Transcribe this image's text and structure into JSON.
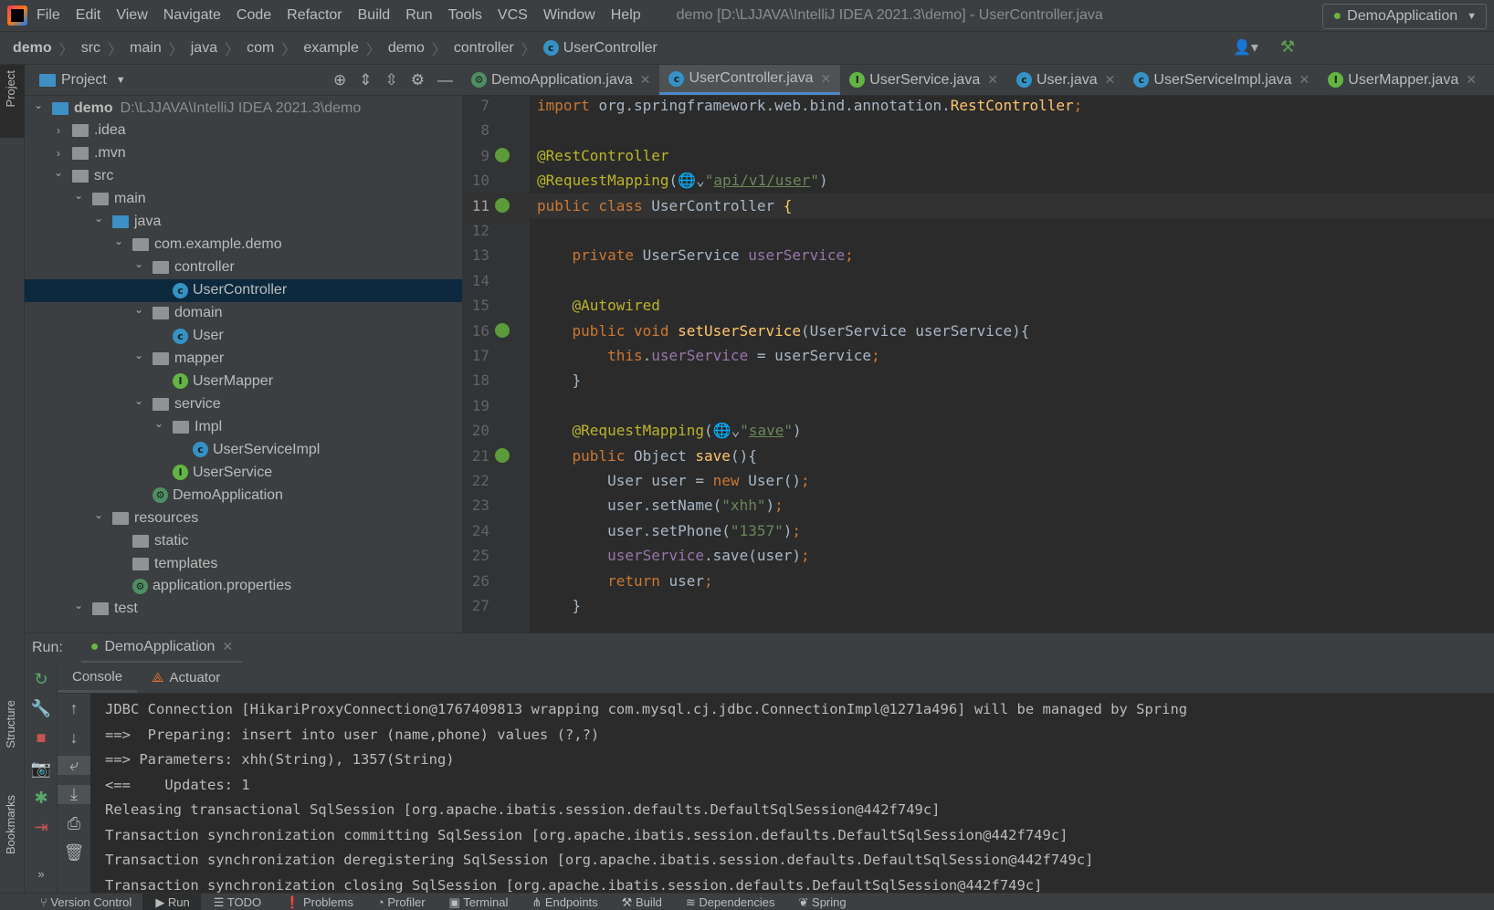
{
  "menubar": {
    "items": [
      "File",
      "Edit",
      "View",
      "Navigate",
      "Code",
      "Refactor",
      "Build",
      "Run",
      "Tools",
      "VCS",
      "Window",
      "Help"
    ],
    "window_title": "demo [D:\\LJJAVA\\IntelliJ IDEA 2021.3\\demo] - UserController.java"
  },
  "breadcrumb": [
    "demo",
    "src",
    "main",
    "java",
    "com",
    "example",
    "demo",
    "controller",
    "UserController"
  ],
  "run_config": {
    "label": "DemoApplication"
  },
  "side_strip": {
    "project": "Project",
    "structure": "Structure",
    "bookmarks": "Bookmarks"
  },
  "project_panel": {
    "title": "Project"
  },
  "tree": [
    {
      "label": "demo",
      "path": "D:\\LJJAVA\\IntelliJ IDEA 2021.3\\demo",
      "depth": 0,
      "exp": "open",
      "icon": "module"
    },
    {
      "label": ".idea",
      "depth": 1,
      "exp": "closed",
      "icon": "folder"
    },
    {
      "label": ".mvn",
      "depth": 1,
      "exp": "closed",
      "icon": "folder"
    },
    {
      "label": "src",
      "depth": 1,
      "exp": "open",
      "icon": "folder"
    },
    {
      "label": "main",
      "depth": 2,
      "exp": "open",
      "icon": "folder"
    },
    {
      "label": "java",
      "depth": 3,
      "exp": "open",
      "icon": "source-folder"
    },
    {
      "label": "com.example.demo",
      "depth": 4,
      "exp": "open",
      "icon": "package"
    },
    {
      "label": "controller",
      "depth": 5,
      "exp": "open",
      "icon": "package"
    },
    {
      "label": "UserController",
      "depth": 6,
      "icon": "class",
      "selected": true
    },
    {
      "label": "domain",
      "depth": 5,
      "exp": "open",
      "icon": "package"
    },
    {
      "label": "User",
      "depth": 6,
      "icon": "class"
    },
    {
      "label": "mapper",
      "depth": 5,
      "exp": "open",
      "icon": "package"
    },
    {
      "label": "UserMapper",
      "depth": 6,
      "icon": "interface"
    },
    {
      "label": "service",
      "depth": 5,
      "exp": "open",
      "icon": "package"
    },
    {
      "label": "Impl",
      "depth": 6,
      "exp": "open",
      "icon": "package"
    },
    {
      "label": "UserServiceImpl",
      "depth": 7,
      "icon": "class"
    },
    {
      "label": "UserService",
      "depth": 6,
      "icon": "interface"
    },
    {
      "label": "DemoApplication",
      "depth": 5,
      "icon": "spring-app"
    },
    {
      "label": "resources",
      "depth": 3,
      "exp": "open",
      "icon": "resources"
    },
    {
      "label": "static",
      "depth": 4,
      "icon": "folder"
    },
    {
      "label": "templates",
      "depth": 4,
      "icon": "folder"
    },
    {
      "label": "application.properties",
      "depth": 4,
      "icon": "spring-props"
    },
    {
      "label": "test",
      "depth": 2,
      "exp": "open",
      "icon": "folder"
    }
  ],
  "tabs": [
    {
      "label": "DemoApplication.java",
      "icon": "spring-app"
    },
    {
      "label": "UserController.java",
      "icon": "class",
      "active": true
    },
    {
      "label": "UserService.java",
      "icon": "interface"
    },
    {
      "label": "User.java",
      "icon": "class"
    },
    {
      "label": "UserServiceImpl.java",
      "icon": "class"
    },
    {
      "label": "UserMapper.java",
      "icon": "interface"
    }
  ],
  "code": [
    {
      "n": "7",
      "t": [
        [
          "import ",
          "kw"
        ],
        [
          "org.springframework.web.bind.annotation.",
          "pl"
        ],
        [
          "RestController",
          "fn"
        ],
        [
          ";",
          "kw"
        ]
      ]
    },
    {
      "n": "8",
      "t": []
    },
    {
      "n": "9",
      "g": "bean",
      "t": [
        [
          "@RestController",
          "an"
        ]
      ]
    },
    {
      "n": "10",
      "t": [
        [
          "@RequestMapping",
          "an"
        ],
        [
          "(",
          "pl"
        ],
        [
          "🌐⌄",
          "pl"
        ],
        [
          "\"",
          "str"
        ],
        [
          "api/v1/user",
          "url"
        ],
        [
          "\"",
          "str"
        ],
        [
          ")",
          "pl"
        ]
      ]
    },
    {
      "n": "11",
      "g": "bean",
      "cur": true,
      "t": [
        [
          "public class ",
          "kw"
        ],
        [
          "UserController ",
          "pl"
        ],
        [
          "{",
          "fn"
        ]
      ]
    },
    {
      "n": "12",
      "t": []
    },
    {
      "n": "13",
      "t": [
        [
          "    private ",
          "kw"
        ],
        [
          "UserService ",
          "pl"
        ],
        [
          "userService",
          "fld"
        ],
        [
          ";",
          "kw"
        ]
      ]
    },
    {
      "n": "14",
      "t": []
    },
    {
      "n": "15",
      "t": [
        [
          "    @Autowired",
          "an"
        ]
      ]
    },
    {
      "n": "16",
      "g": "bean",
      "t": [
        [
          "    public void ",
          "kw"
        ],
        [
          "setUserService",
          "fn"
        ],
        [
          "(UserService userService){",
          "pl"
        ]
      ]
    },
    {
      "n": "17",
      "t": [
        [
          "        this",
          "kw"
        ],
        [
          ".",
          "pl"
        ],
        [
          "userService",
          "fld"
        ],
        [
          " = userService",
          "pl"
        ],
        [
          ";",
          "kw"
        ]
      ]
    },
    {
      "n": "18",
      "t": [
        [
          "    }",
          "pl"
        ]
      ]
    },
    {
      "n": "19",
      "t": []
    },
    {
      "n": "20",
      "t": [
        [
          "    @RequestMapping",
          "an"
        ],
        [
          "(",
          "pl"
        ],
        [
          "🌐⌄",
          "pl"
        ],
        [
          "\"",
          "str"
        ],
        [
          "save",
          "url"
        ],
        [
          "\"",
          "str"
        ],
        [
          ")",
          "pl"
        ]
      ]
    },
    {
      "n": "21",
      "g": "bean",
      "t": [
        [
          "    public ",
          "kw"
        ],
        [
          "Object ",
          "pl"
        ],
        [
          "save",
          "fn"
        ],
        [
          "(){",
          "pl"
        ]
      ]
    },
    {
      "n": "22",
      "t": [
        [
          "        User user = ",
          "pl"
        ],
        [
          "new ",
          "kw"
        ],
        [
          "User()",
          "pl"
        ],
        [
          ";",
          "kw"
        ]
      ]
    },
    {
      "n": "23",
      "t": [
        [
          "        user.setName(",
          "pl"
        ],
        [
          "\"xhh\"",
          "str"
        ],
        [
          ")",
          "pl"
        ],
        [
          ";",
          "kw"
        ]
      ]
    },
    {
      "n": "24",
      "t": [
        [
          "        user.setPhone(",
          "pl"
        ],
        [
          "\"1357\"",
          "str"
        ],
        [
          ")",
          "pl"
        ],
        [
          ";",
          "kw"
        ]
      ]
    },
    {
      "n": "25",
      "t": [
        [
          "        userService",
          "fld"
        ],
        [
          ".save(user)",
          "pl"
        ],
        [
          ";",
          "kw"
        ]
      ]
    },
    {
      "n": "26",
      "t": [
        [
          "        return ",
          "kw"
        ],
        [
          "user",
          "pl"
        ],
        [
          ";",
          "kw"
        ]
      ]
    },
    {
      "n": "27",
      "t": [
        [
          "    }",
          "pl"
        ]
      ]
    }
  ],
  "run_panel": {
    "label": "Run:",
    "tab": "DemoApplication",
    "console_tab": "Console",
    "actuator_tab": "Actuator"
  },
  "console": [
    "JDBC Connection [HikariProxyConnection@1767409813 wrapping com.mysql.cj.jdbc.ConnectionImpl@1271a496] will be managed by Spring",
    "==>  Preparing: insert into user (name,phone) values (?,?)",
    "==> Parameters: xhh(String), 1357(String)",
    "<==    Updates: 1",
    "Releasing transactional SqlSession [org.apache.ibatis.session.defaults.DefaultSqlSession@442f749c]",
    "Transaction synchronization committing SqlSession [org.apache.ibatis.session.defaults.DefaultSqlSession@442f749c]",
    "Transaction synchronization deregistering SqlSession [org.apache.ibatis.session.defaults.DefaultSqlSession@442f749c]",
    "Transaction synchronization closing SqlSession [org.apache.ibatis.session.defaults.DefaultSqlSession@442f749c]"
  ],
  "statusbar": [
    {
      "label": "Version Control",
      "icon": "branch"
    },
    {
      "label": "Run",
      "icon": "play",
      "active": true
    },
    {
      "label": "TODO",
      "icon": "list"
    },
    {
      "label": "Problems",
      "icon": "warning"
    },
    {
      "label": "Profiler",
      "icon": "profiler"
    },
    {
      "label": "Terminal",
      "icon": "terminal"
    },
    {
      "label": "Endpoints",
      "icon": "endpoints"
    },
    {
      "label": "Build",
      "icon": "hammer"
    },
    {
      "label": "Dependencies",
      "icon": "layers"
    },
    {
      "label": "Spring",
      "icon": "leaf"
    }
  ],
  "colors": {
    "accent": "#4a88c7",
    "selection": "#0d293e",
    "keyword": "#cc7832",
    "annotation": "#bbb529",
    "string": "#6a8759",
    "field": "#9876aa",
    "method": "#ffc66d"
  }
}
